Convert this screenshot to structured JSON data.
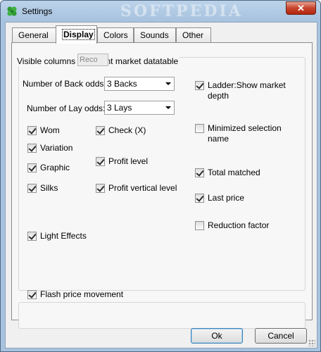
{
  "window": {
    "title": "Settings",
    "watermark": "SOFTPEDIA",
    "close_label": "✕"
  },
  "tabs": [
    "General",
    "Display",
    "Colors",
    "Sounds",
    "Other"
  ],
  "active_tab": "Display",
  "display": {
    "group_label": "Visible columns in current market datatable",
    "tooltip_text": "Reco",
    "back_odds": {
      "label": "Number of Back odds:",
      "value": "3 Backs"
    },
    "lay_odds": {
      "label": "Number of Lay odds:",
      "value": "3 Lays"
    },
    "checkboxes": {
      "wom": {
        "label": "Wom",
        "checked": true
      },
      "variation": {
        "label": "Variation",
        "checked": true
      },
      "graphic": {
        "label": "Graphic",
        "checked": true
      },
      "silks": {
        "label": "Silks",
        "checked": true
      },
      "light_effects": {
        "label": "Light Effects",
        "checked": true
      },
      "check_x": {
        "label": "Check (X)",
        "checked": true
      },
      "profit_level": {
        "label": "Profit level",
        "checked": true
      },
      "profit_vertical_level": {
        "label": "Profit vertical level",
        "checked": true
      },
      "ladder_depth": {
        "label": "Ladder:Show market depth",
        "checked": true
      },
      "minimized_selection": {
        "label": "Minimized selection name",
        "checked": false
      },
      "total_matched": {
        "label": "Total matched",
        "checked": true
      },
      "last_price": {
        "label": "Last price",
        "checked": true
      },
      "reduction_factor": {
        "label": "Reduction factor",
        "checked": false
      },
      "flash_price": {
        "label": "Flash price movement",
        "checked": true
      }
    }
  },
  "buttons": {
    "ok": "Ok",
    "cancel": "Cancel"
  },
  "colors": {
    "title_gradient_top": "#bcd3ea",
    "close_red": "#c7432b",
    "dialog_bg": "#f0f0f0"
  }
}
